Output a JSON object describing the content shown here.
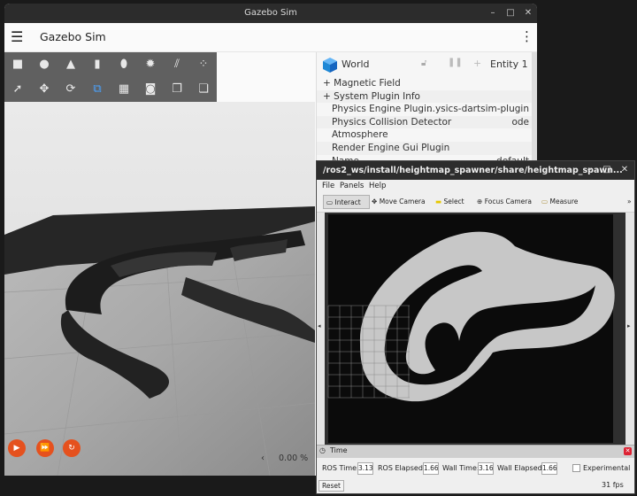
{
  "gazebo": {
    "window_title": "Gazebo Sim",
    "app_name": "Gazebo Sim",
    "window_controls": {
      "minimize": "–",
      "maximize": "□",
      "close": "✕"
    },
    "menu_icon": "hamburger-icon",
    "toolbar_icons": [
      "box-icon",
      "sphere-icon",
      "cone-icon",
      "cylinder-icon",
      "capsule-icon",
      "sun-icon",
      "directional-light-icon",
      "spot-light-icon",
      "select-icon",
      "translate-icon",
      "rotate-icon",
      "snap-icon",
      "grid-icon",
      "camera-icon",
      "copy-icon",
      "paste-icon"
    ],
    "playback": {
      "play": "▶",
      "step": "⏩",
      "reset": "↻"
    },
    "rtf": "0.00 %",
    "rtf_arrow": "‹",
    "entity_tree": {
      "title": "World",
      "entity": "Entity 1",
      "rows": [
        {
          "label": "+ Magnetic Field",
          "value": ""
        },
        {
          "label": "+ System Plugin Info",
          "value": ""
        },
        {
          "label": "Physics Engine Plugin",
          "value": "...ysics-dartsim-plugin"
        },
        {
          "label": "Physics Collision Detector",
          "value": "ode"
        },
        {
          "label": "Atmosphere",
          "value": ""
        },
        {
          "label": "Render Engine Gui Plugin",
          "value": ""
        },
        {
          "label": "Name",
          "value": "default"
        }
      ]
    }
  },
  "rviz": {
    "window_title": "/ros2_ws/install/heightmap_spawner/share/heightmap_spawn...",
    "menus": [
      "File",
      "Panels",
      "Help"
    ],
    "tools": [
      {
        "label": "Interact",
        "icon": "interact-icon"
      },
      {
        "label": "Move Camera",
        "icon": "move-camera-icon"
      },
      {
        "label": "Select",
        "icon": "select-icon"
      },
      {
        "label": "Focus Camera",
        "icon": "focus-camera-icon"
      },
      {
        "label": "Measure",
        "icon": "measure-icon"
      }
    ],
    "more": "»",
    "side_arrow_left": "◂",
    "side_arrow_right": "▸",
    "time_panel": {
      "title": "Time",
      "ros_time_label": "ROS Time:",
      "ros_time": "3.13",
      "ros_elapsed_label": "ROS Elapsed:",
      "ros_elapsed": "1.66",
      "wall_time_label": "Wall Time:",
      "wall_time": "3.16",
      "wall_elapsed_label": "Wall Elapsed:",
      "wall_elapsed": "1.66",
      "experimental": "Experimental",
      "reset": "Reset",
      "fps": "31 fps"
    }
  },
  "colors": {
    "accent": "#e5511e",
    "gazebo_cube": "#1e88d6"
  }
}
